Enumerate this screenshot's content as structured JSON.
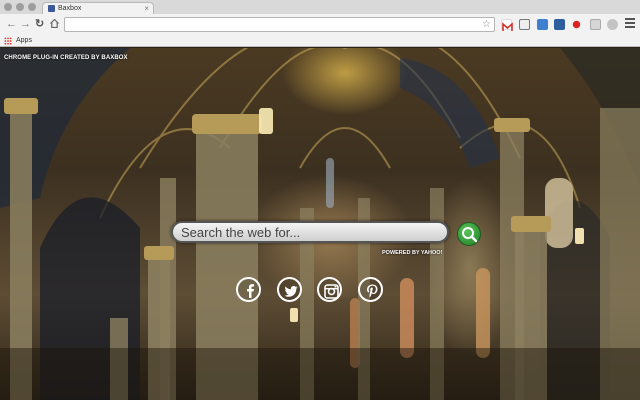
{
  "browser": {
    "tab_title": "Baxbox",
    "tab_close": "×",
    "omnibox_value": "",
    "bookmarks": [
      {
        "label": "Apps"
      }
    ]
  },
  "page": {
    "credit": "CHROME PLUG-IN CREATED BY BAXBOX",
    "search_placeholder": "Search the web for...",
    "powered_by": "POWERED BY YAHOO!",
    "social": [
      {
        "name": "facebook-icon"
      },
      {
        "name": "twitter-icon"
      },
      {
        "name": "instagram-icon"
      },
      {
        "name": "pinterest-icon"
      }
    ]
  },
  "colors": {
    "search_button": "#2f9e35",
    "accent_red": "#d0312d"
  }
}
